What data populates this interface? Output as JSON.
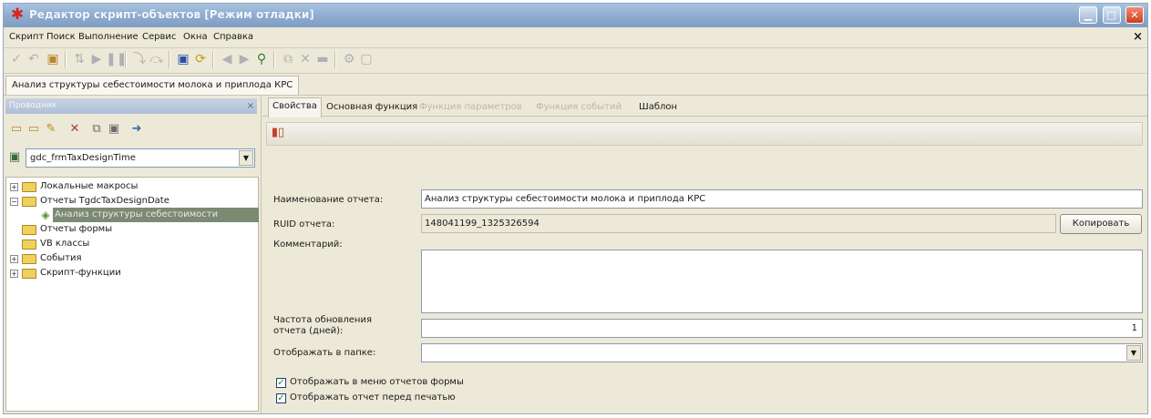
{
  "window": {
    "title": "Редактор скрипт-объектов [Режим отладки]",
    "app_icon": "gedemin-logo-icon",
    "controls": {
      "minimize": "minimize-icon",
      "maximize": "maximize-icon",
      "close": "close-icon"
    }
  },
  "menu": {
    "items": [
      "Скрипт",
      "Поиск",
      "Выполнение",
      "Сервис",
      "Окна",
      "Справка"
    ],
    "mdi_close": "×"
  },
  "toolbar": {
    "icons": [
      "check-icon",
      "undo-icon",
      "compile-icon",
      "step-icon",
      "run-icon",
      "pause-icon",
      "step-into-icon",
      "step-over-icon",
      "save-icon",
      "reload-icon",
      "prev-icon",
      "next-icon",
      "find-icon",
      "copy-icon",
      "delete-icon",
      "clear-icon",
      "settings-icon",
      "page-icon"
    ]
  },
  "document_tab": {
    "label": "Анализ структуры себестоимости молока и приплода КРС"
  },
  "explorer": {
    "header": "Проводник",
    "close": "×",
    "toolbar_icons": [
      "new-folder-icon",
      "open-folder-icon",
      "edit-icon",
      "delete-icon",
      "copy-icon",
      "paste-icon",
      "link-icon"
    ],
    "object_combo": {
      "value": "gdc_frmTaxDesignTime"
    },
    "tree": [
      {
        "label": "Локальные макросы",
        "level": 0,
        "expander": "+"
      },
      {
        "label": "Отчеты TgdcTaxDesignDate",
        "level": 0,
        "expander": "−"
      },
      {
        "label": "Анализ структуры себестоимости",
        "level": 1,
        "selected": true
      },
      {
        "label": "Отчеты формы",
        "level": 0
      },
      {
        "label": "VB классы",
        "level": 0
      },
      {
        "label": "События",
        "level": 0,
        "expander": "+"
      },
      {
        "label": "Скрипт-функции",
        "level": 0,
        "expander": "+"
      }
    ]
  },
  "editor": {
    "tabs": [
      {
        "label": "Свойства",
        "state": "active"
      },
      {
        "label": "Основная функция",
        "state": "normal"
      },
      {
        "label": "Функция параметров",
        "state": "disabled"
      },
      {
        "label": "Функция событий",
        "state": "disabled"
      },
      {
        "label": "Шаблон",
        "state": "normal"
      }
    ],
    "subtoolbar_icon": "report-icon",
    "form": {
      "name_label": "Наименование отчета:",
      "name_value": "Анализ структуры себестоимости молока и приплода КРС",
      "ruid_label": "RUID отчета:",
      "ruid_value": "148041199_1325326594",
      "copy_button": "Копировать",
      "comment_label": "Комментарий:",
      "comment_value": "",
      "refresh_label_line1": "Частота обновления",
      "refresh_label_line2": "отчета (дней):",
      "refresh_value": "1",
      "folder_label": "Отображать в папке:",
      "folder_value": "",
      "checkbox_menu": {
        "label": "Отображать в меню отчетов формы",
        "checked": true
      },
      "checkbox_preview": {
        "label": "Отображать отчет перед печатью",
        "checked": true
      }
    }
  },
  "colors": {
    "titlebar": "#8eabcf",
    "window_bg": "#ece9d8",
    "tree_selection": "#7c8a74",
    "close_button": "#c9401f"
  }
}
